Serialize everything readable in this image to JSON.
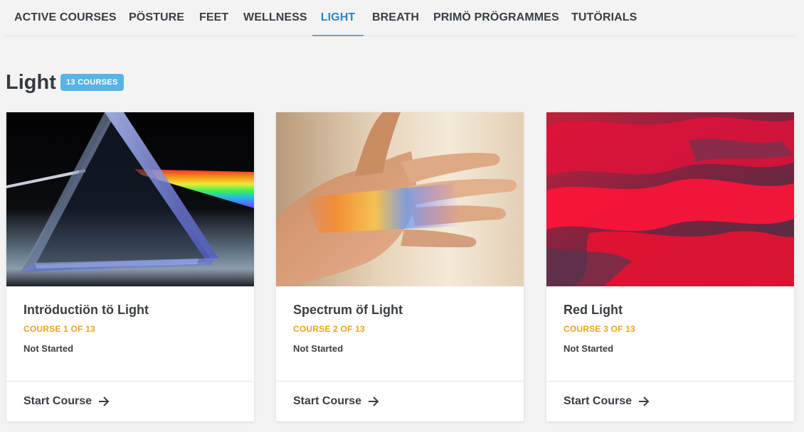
{
  "tabs": [
    {
      "label": "ACTIVE COURSES",
      "active": false
    },
    {
      "label": "PÖSTURE",
      "active": false
    },
    {
      "label": "FEET",
      "active": false
    },
    {
      "label": "WELLNESS",
      "active": false
    },
    {
      "label": "LIGHT",
      "active": true
    },
    {
      "label": "BREATH",
      "active": false
    },
    {
      "label": "PRIMÖ PRÖGRAMMES",
      "active": false
    },
    {
      "label": "TUTÖRIALS",
      "active": false
    }
  ],
  "section": {
    "title": "Light",
    "count_badge": "13 COURSES"
  },
  "cards": [
    {
      "title": "Intröductiön tö Light",
      "meta": "COURSE 1 OF 13",
      "status": "Not Started",
      "action": "Start Course",
      "image": "prism-image"
    },
    {
      "title": "Spectrum öf Light",
      "meta": "COURSE 2 OF 13",
      "status": "Not Started",
      "action": "Start Course",
      "image": "hand-spectrum-image"
    },
    {
      "title": "Red Light",
      "meta": "COURSE 3 OF 13",
      "status": "Not Started",
      "action": "Start Course",
      "image": "red-sky-image"
    }
  ],
  "colors": {
    "accent": "#2e86c1",
    "badge": "#58b4e6",
    "meta": "#f0a21b",
    "text": "#3a3f45",
    "background": "#f3f3f3"
  }
}
